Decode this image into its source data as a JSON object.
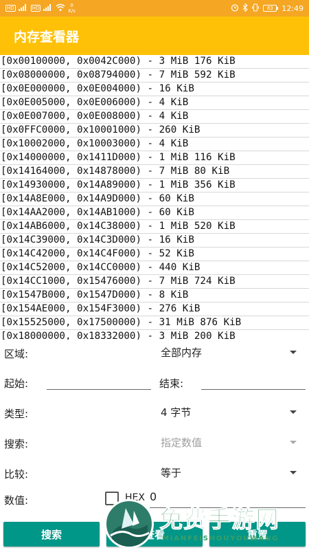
{
  "status_bar": {
    "network_badges": [
      "HD",
      "HD"
    ],
    "signal_1": "4G",
    "signal_2": "4G",
    "speed_value": "0",
    "speed_unit": "K/s",
    "icons": [
      "alarm-icon",
      "bluetooth-icon",
      "vibrate-icon",
      "battery-icon"
    ],
    "battery_level": "83",
    "time": "12:49"
  },
  "app": {
    "title": "内存查看器",
    "accent_color": "#FFC107",
    "button_color": "#009688"
  },
  "memory_regions": [
    "[0x00100000, 0x0042C000) - 3 MiB 176 KiB",
    "[0x08000000, 0x08794000) - 7 MiB 592 KiB",
    "[0x0E000000, 0x0E004000) - 16 KiB",
    "[0x0E005000, 0x0E006000) - 4 KiB",
    "[0x0E007000, 0x0E008000) - 4 KiB",
    "[0x0FFC0000, 0x10001000) - 260 KiB",
    "[0x10002000, 0x10003000) - 4 KiB",
    "[0x14000000, 0x1411D000) - 1 MiB 116 KiB",
    "[0x14164000, 0x14878000) - 7 MiB 80 KiB",
    "[0x14930000, 0x14A89000) - 1 MiB 356 KiB",
    "[0x14A8E000, 0x14A9D000) - 60 KiB",
    "[0x14AA2000, 0x14AB1000) - 60 KiB",
    "[0x14AB6000, 0x14C38000) - 1 MiB 520 KiB",
    "[0x14C39000, 0x14C3D000) - 16 KiB",
    "[0x14C42000, 0x14C4F000) - 52 KiB",
    "[0x14C52000, 0x14CC0000) - 440 KiB",
    "[0x14CC1000, 0x15476000) - 7 MiB 724 KiB",
    "[0x1547B000, 0x1547D000) - 8 KiB",
    "[0x154AE000, 0x154F3000) - 276 KiB",
    "[0x15525000, 0x17500000) - 31 MiB 876 KiB",
    "[0x18000000, 0x18332000) - 3 MiB 200 KiB"
  ],
  "form": {
    "region_label": "区域:",
    "region_value": "全部内存",
    "start_label": "起始:",
    "start_value": "",
    "end_label": "结束:",
    "end_value": "",
    "type_label": "类型:",
    "type_value": "4 字节",
    "search_label": "搜索:",
    "search_placeholder": "指定数值",
    "compare_label": "比较:",
    "compare_value": "等于",
    "value_label": "数值:",
    "hex_label": "HEX",
    "hex_checked": false,
    "value_input": "0"
  },
  "buttons": {
    "search": "搜索",
    "view": "查看",
    "reset": "重置"
  },
  "watermark": {
    "text": "免费手游网",
    "subtext": "MIANFEISHOUYOUWANG"
  }
}
